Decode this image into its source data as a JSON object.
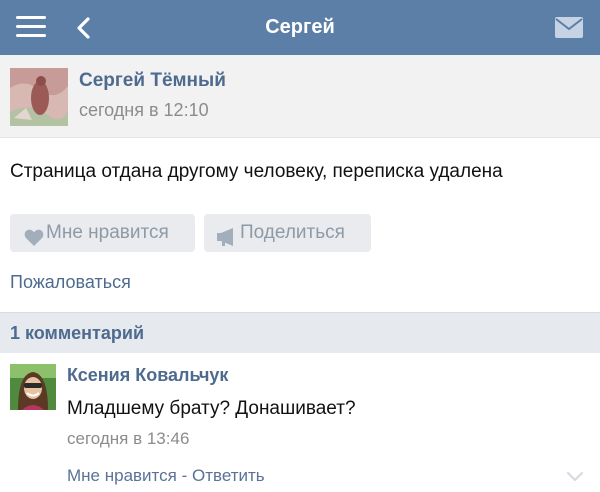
{
  "topbar": {
    "title": "Сергей",
    "menu_icon": "menu-icon",
    "back_icon": "back-icon",
    "mail_icon": "mail-icon",
    "bg_color": "#5b7fa6"
  },
  "post": {
    "author": "Сергей Тёмный",
    "time": "сегодня в 12:10",
    "text": "Страница отдана другому человеку, переписка удалена",
    "like_label": "Мне нравится",
    "share_label": "Поделиться",
    "report_label": "Пожаловаться"
  },
  "comments": {
    "count_label": "1 комментарий",
    "items": [
      {
        "author": "Ксения Ковальчук",
        "text": "Младшему брату? Донашивает?",
        "time": "сегодня в 13:46",
        "like_label": "Мне нравится",
        "separator": " - ",
        "reply_label": "Ответить"
      }
    ]
  },
  "colors": {
    "link": "#4e6b8f",
    "muted": "#8c8c8c"
  }
}
